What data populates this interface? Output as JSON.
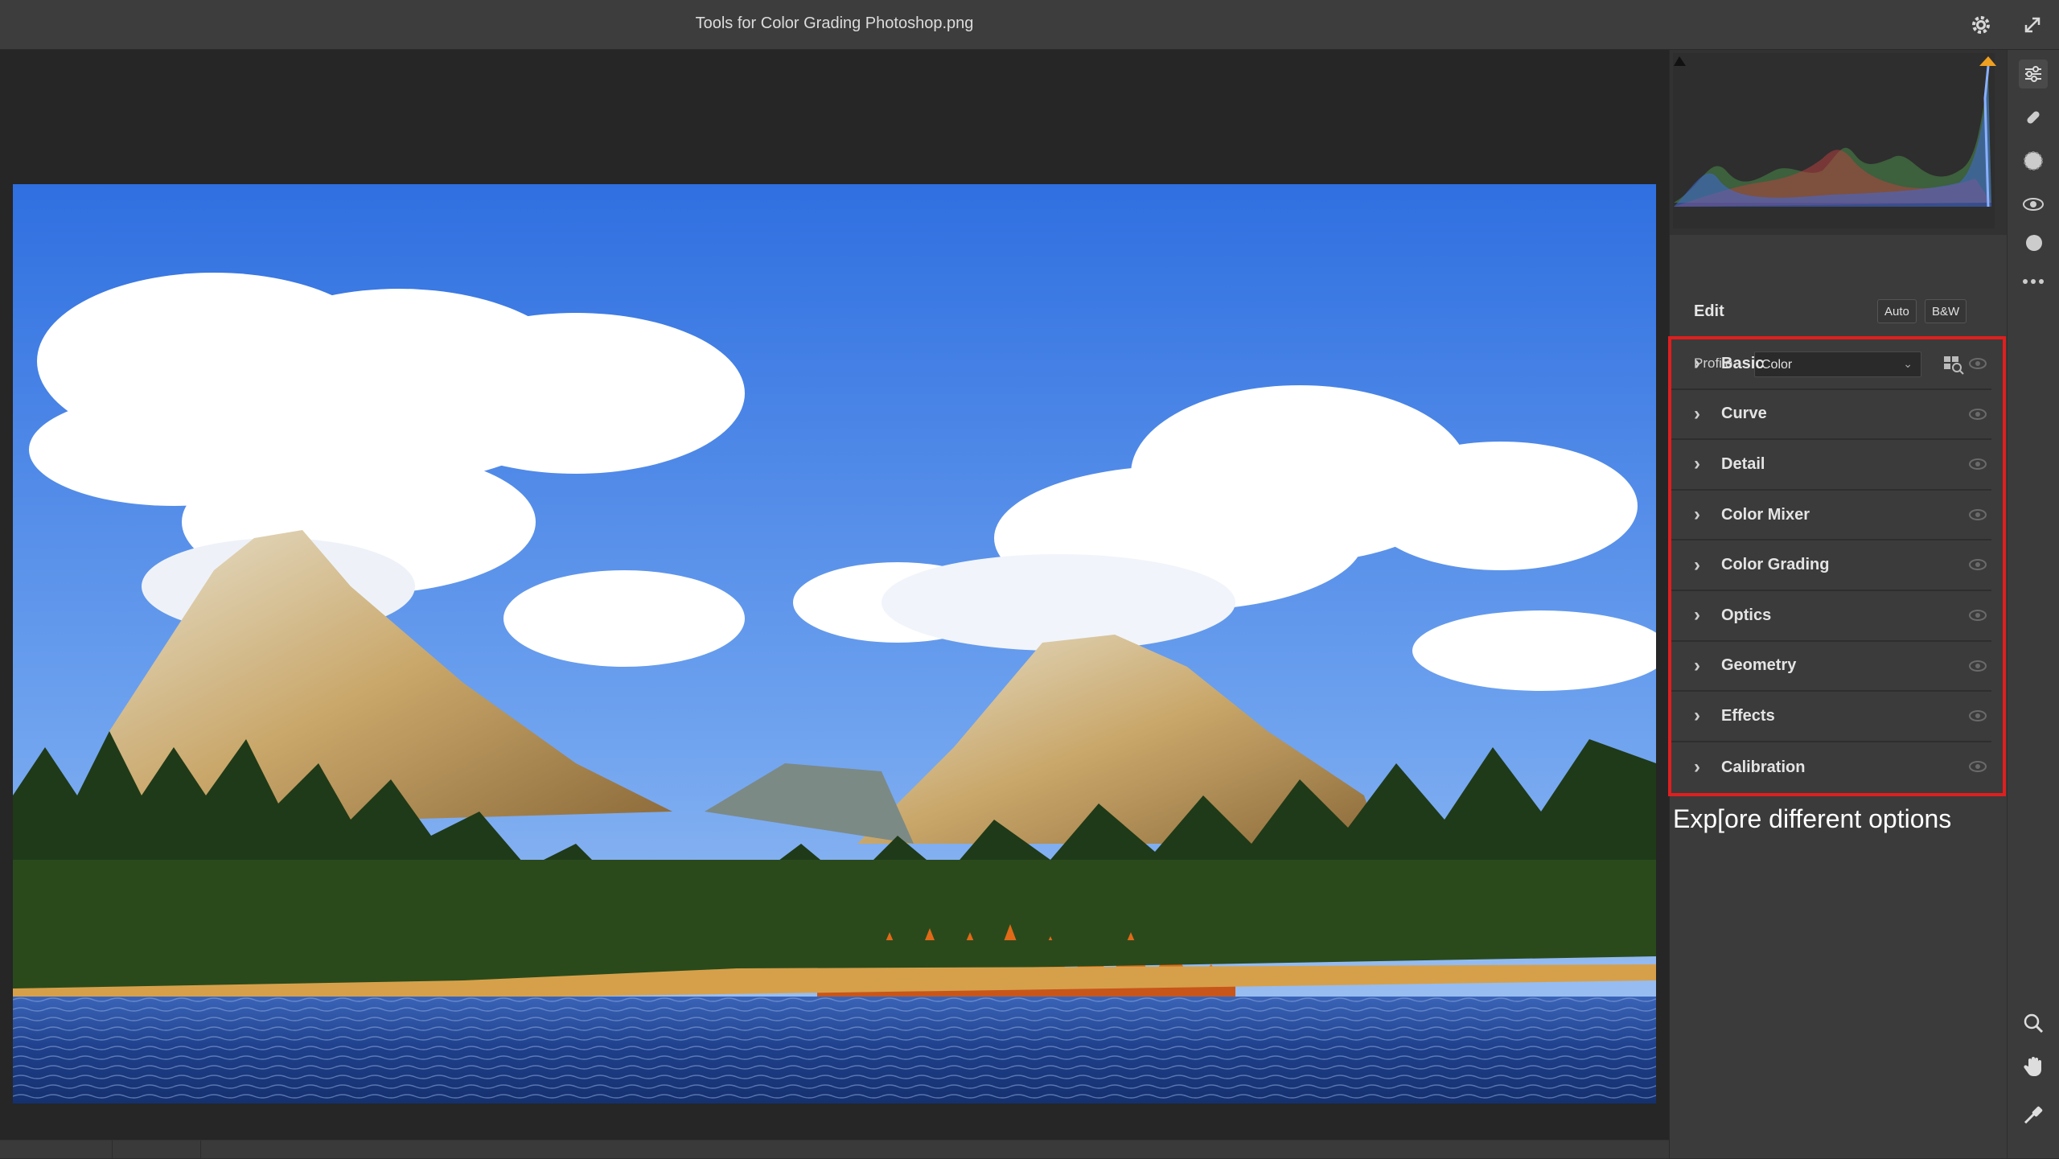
{
  "window": {
    "title": "Tools for Color Grading Photoshop.png"
  },
  "edit_panel": {
    "title": "Edit",
    "auto_label": "Auto",
    "bw_label": "B&W",
    "profile_label": "Profile",
    "profile_value": "Color",
    "sections": [
      {
        "label": "Basic"
      },
      {
        "label": "Curve"
      },
      {
        "label": "Detail"
      },
      {
        "label": "Color Mixer"
      },
      {
        "label": "Color Grading"
      },
      {
        "label": "Optics"
      },
      {
        "label": "Geometry"
      },
      {
        "label": "Effects"
      },
      {
        "label": "Calibration"
      }
    ],
    "highlight_color": "#e01e1e"
  },
  "annotation": {
    "caption": "Exp[ore different options"
  },
  "icons": {
    "titlebar": [
      "gear-icon",
      "expand-icon"
    ],
    "tools_top": [
      "edit-sliders-icon",
      "healing-brush-icon",
      "masking-icon",
      "red-eye-icon",
      "presets-icon",
      "more-icon"
    ],
    "tools_bottom": [
      "zoom-icon",
      "hand-icon",
      "color-sampler-icon"
    ]
  }
}
